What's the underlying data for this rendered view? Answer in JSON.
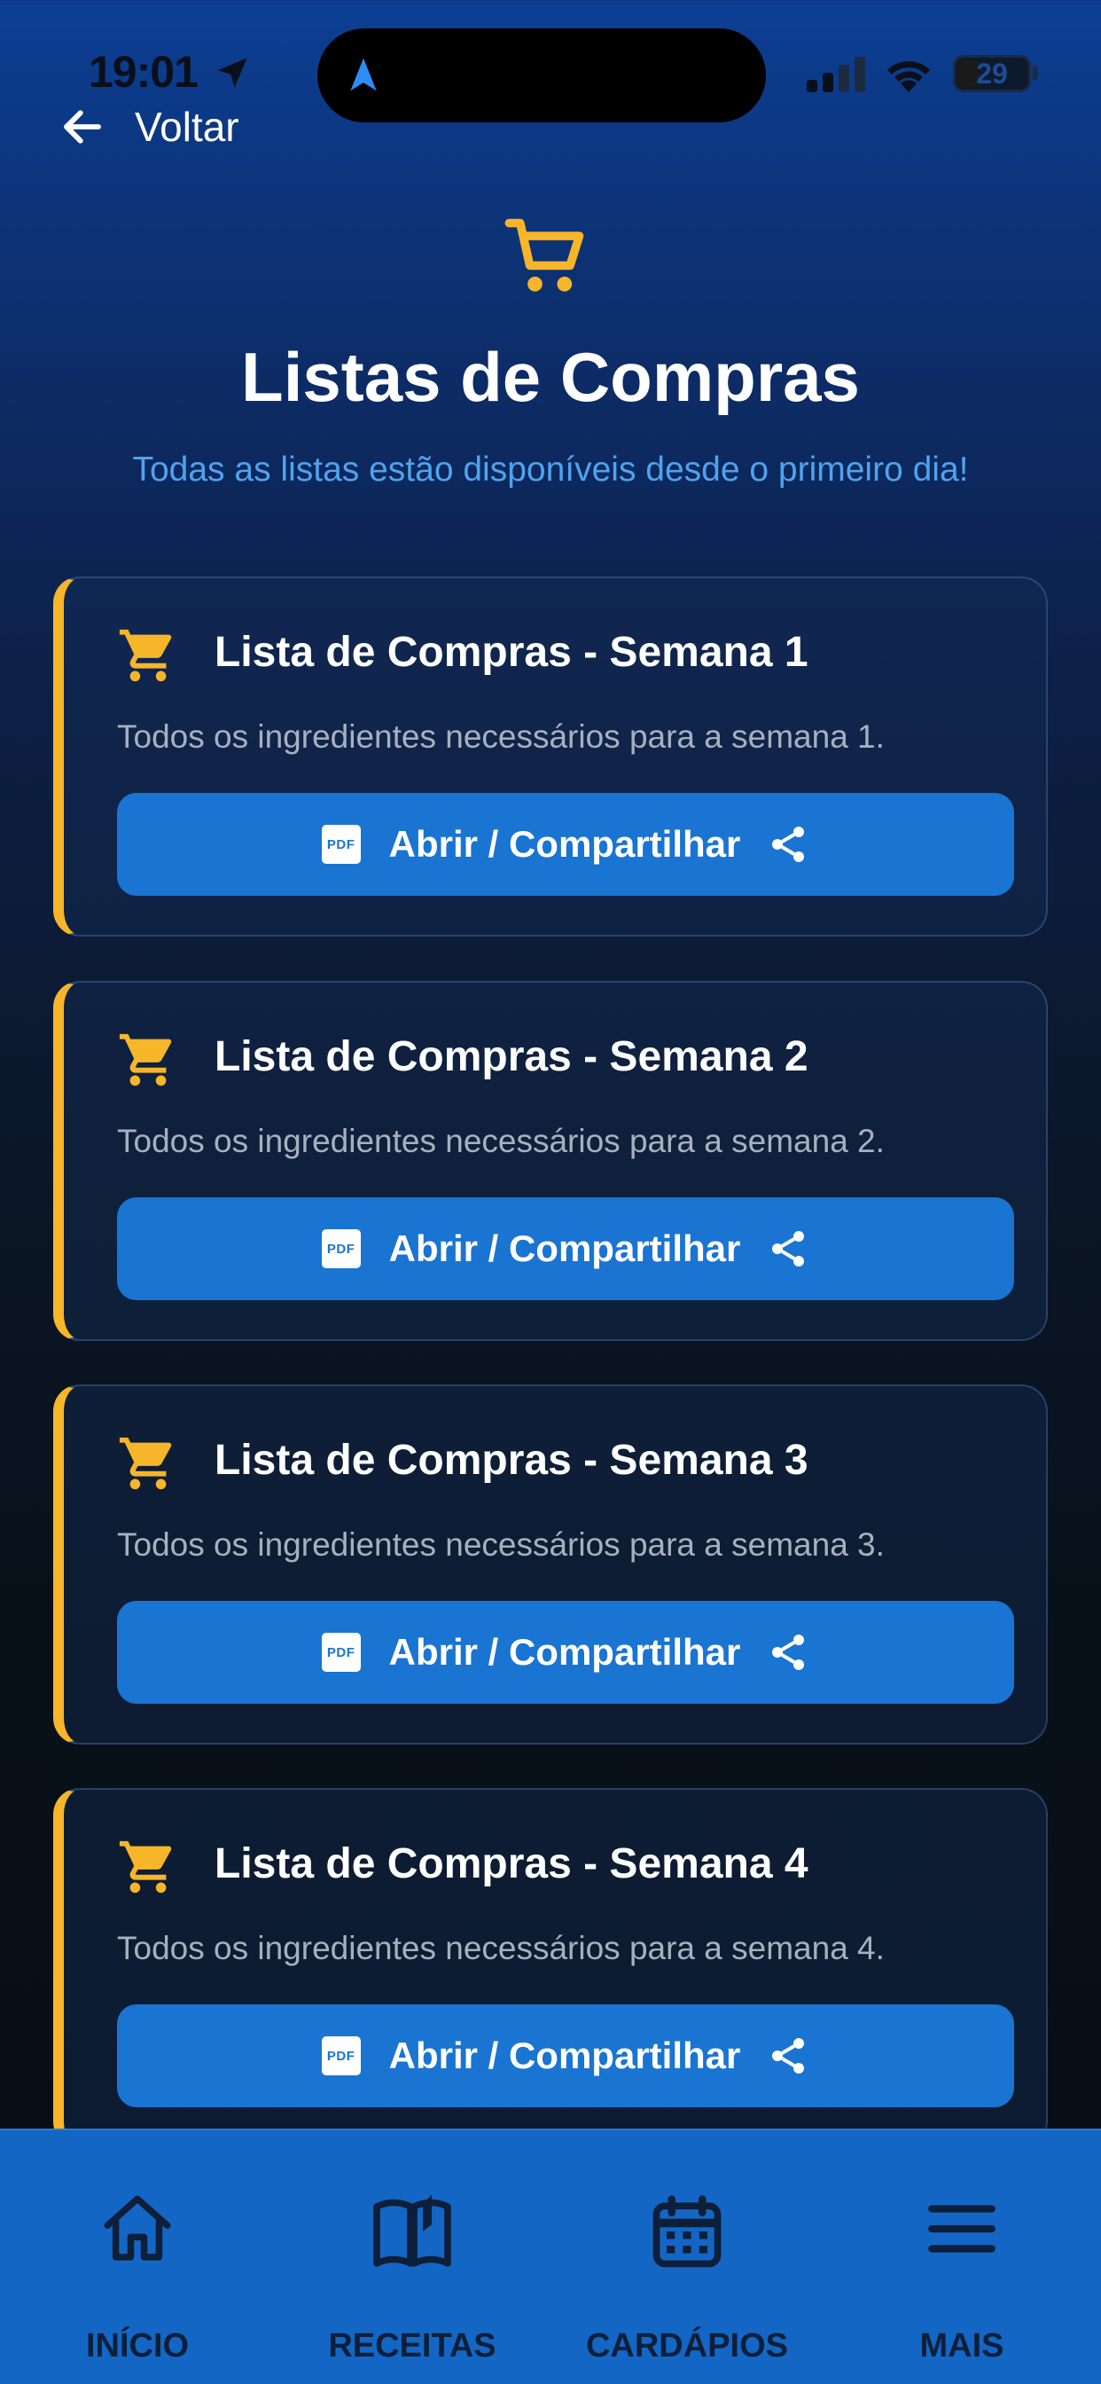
{
  "status_bar": {
    "time": "19:01",
    "battery": "29"
  },
  "nav": {
    "back_label": "Voltar"
  },
  "header": {
    "title": "Listas de Compras",
    "subtitle": "Todas as listas estão disponíveis desde o primeiro dia!"
  },
  "lists": [
    {
      "title": "Lista de Compras - Semana 1",
      "description": "Todos os ingredientes necessários para a semana 1.",
      "button_label": "Abrir / Compartilhar",
      "pdf_badge": "PDF"
    },
    {
      "title": "Lista de Compras - Semana 2",
      "description": "Todos os ingredientes necessários para a semana 2.",
      "button_label": "Abrir / Compartilhar",
      "pdf_badge": "PDF"
    },
    {
      "title": "Lista de Compras - Semana 3",
      "description": "Todos os ingredientes necessários para a semana 3.",
      "button_label": "Abrir / Compartilhar",
      "pdf_badge": "PDF"
    },
    {
      "title": "Lista de Compras - Semana 4",
      "description": "Todos os ingredientes necessários para a semana 4.",
      "button_label": "Abrir / Compartilhar",
      "pdf_badge": "PDF"
    }
  ],
  "bottom_nav": [
    {
      "label": "INÍCIO",
      "icon": "home-icon"
    },
    {
      "label": "RECEITAS",
      "icon": "book-icon"
    },
    {
      "label": "CARDÁPIOS",
      "icon": "calendar-icon"
    },
    {
      "label": "MAIS",
      "icon": "menu-icon"
    }
  ],
  "colors": {
    "accent": "#f7b52a",
    "primary_button": "#1a74d2",
    "subtitle": "#4fa3ef",
    "bottom_nav_bg": "#1466c4"
  }
}
